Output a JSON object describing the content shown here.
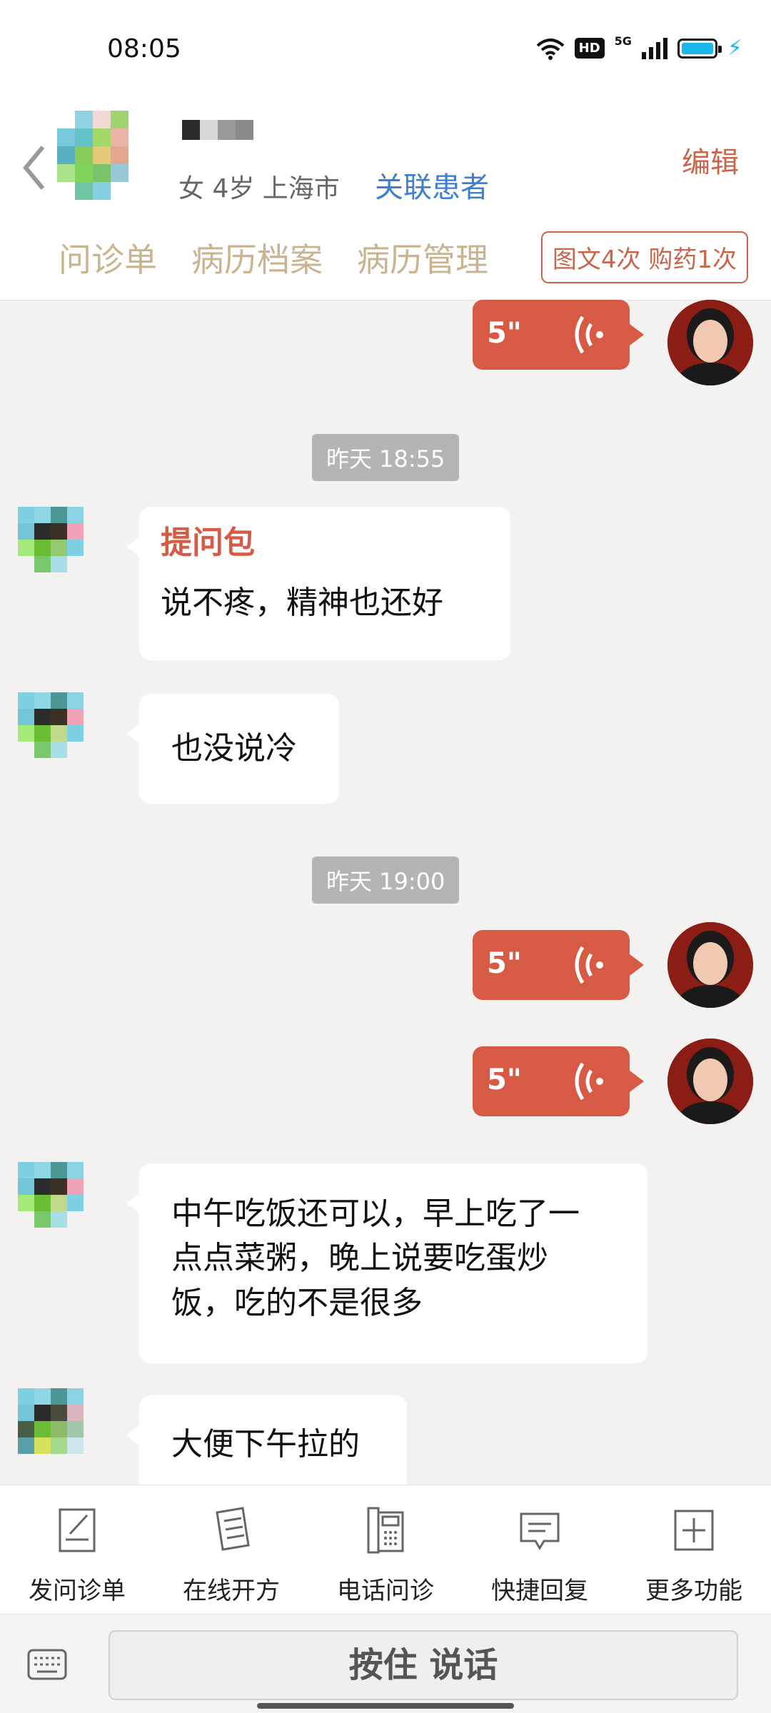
{
  "status_bar": {
    "time": "08:05",
    "hd": "HD",
    "network": "5G"
  },
  "header": {
    "patient_info": "女 4岁  上海市",
    "link_patient": "关联患者",
    "edit": "编辑",
    "tabs": [
      "问诊单",
      "病历档案",
      "病历管理"
    ],
    "count_badge": "图文4次 购药1次"
  },
  "chat": {
    "messages": [
      {
        "side": "right",
        "type": "voice",
        "duration": "5\""
      },
      {
        "type": "timestamp",
        "text": "昨天 18:55"
      },
      {
        "side": "left",
        "type": "question",
        "title": "提问包",
        "text": "说不疼，精神也还好"
      },
      {
        "side": "left",
        "type": "text",
        "text": "也没说冷"
      },
      {
        "type": "timestamp",
        "text": "昨天 19:00"
      },
      {
        "side": "right",
        "type": "voice",
        "duration": "5\""
      },
      {
        "side": "right",
        "type": "voice",
        "duration": "5\""
      },
      {
        "side": "left",
        "type": "text",
        "lines": [
          "中午吃饭还可以，早上吃了一",
          "点点菜粥，晚上说要吃蛋炒",
          "饭，吃的不是很多"
        ]
      },
      {
        "side": "left",
        "type": "text",
        "text": "大便下午拉的"
      }
    ]
  },
  "toolbar": {
    "items": [
      {
        "label": "发问诊单",
        "icon": "form-edit-icon"
      },
      {
        "label": "在线开方",
        "icon": "prescription-icon"
      },
      {
        "label": "电话问诊",
        "icon": "phone-icon"
      },
      {
        "label": "快捷回复",
        "icon": "quick-reply-icon"
      },
      {
        "label": "更多功能",
        "icon": "plus-icon"
      }
    ]
  },
  "input": {
    "voice_button": "按住 说话",
    "keyboard_icon": "keyboard-icon"
  },
  "colors": {
    "accent": "#d65a44",
    "link": "#3f7fd1",
    "tab": "#c9b48f",
    "background": "#f3f2f0"
  }
}
